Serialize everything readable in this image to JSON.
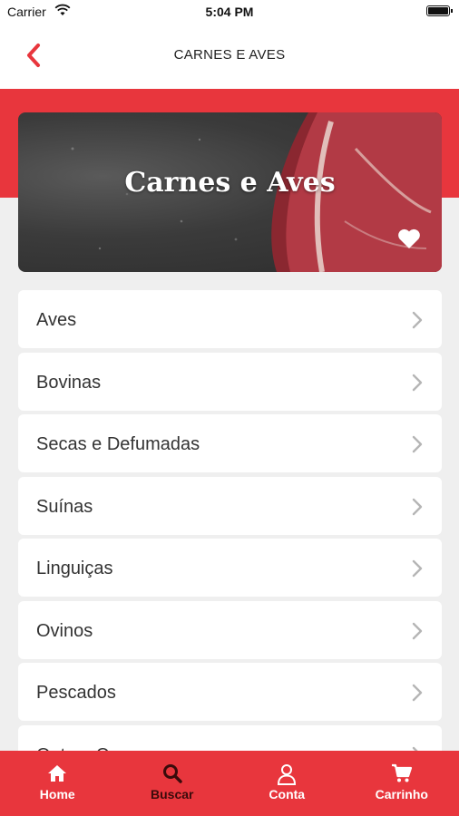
{
  "status_bar": {
    "carrier": "Carrier",
    "time": "5:04 PM"
  },
  "nav": {
    "title": "CARNES E AVES",
    "back_icon": "chevron-left-icon"
  },
  "hero": {
    "title": "Carnes e Aves",
    "favorite_icon": "heart-icon"
  },
  "categories": [
    {
      "label": "Aves"
    },
    {
      "label": "Bovinas"
    },
    {
      "label": "Secas e Defumadas"
    },
    {
      "label": "Suínas"
    },
    {
      "label": "Linguiças"
    },
    {
      "label": "Ovinos"
    },
    {
      "label": "Pescados"
    },
    {
      "label": "Outras Carnes"
    }
  ],
  "tabs": [
    {
      "label": "Home",
      "icon": "home-icon"
    },
    {
      "label": "Buscar",
      "icon": "search-icon",
      "active": true
    },
    {
      "label": "Conta",
      "icon": "user-icon"
    },
    {
      "label": "Carrinho",
      "icon": "cart-icon"
    }
  ],
  "colors": {
    "brand_red": "#e8363d",
    "active_tab_text": "#3a0b0b"
  }
}
